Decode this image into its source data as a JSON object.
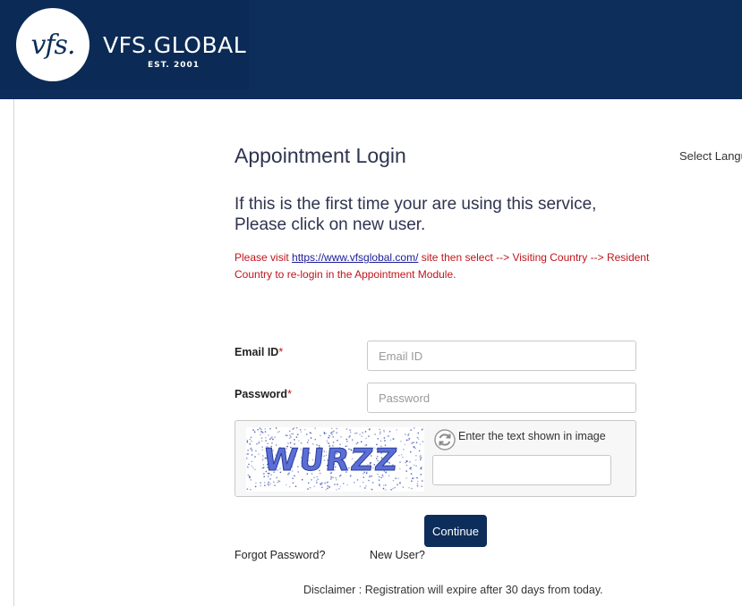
{
  "header": {
    "logo_mark": "vfs.",
    "brand": "VFS.GLOBAL",
    "established": "EST. 2001",
    "background_color": "#0d2d5a"
  },
  "main": {
    "title": "Appointment Login",
    "language_selector": "Select Language",
    "intro_line1": "If this is the first time your are using this service,",
    "intro_line2": "Please click on new user.",
    "notice_prefix": "Please visit ",
    "notice_link": "https://www.vfsglobal.com/",
    "notice_suffix": " site then select --> Visiting Country --> Resident Country to re-login in the Appointment Module.",
    "notice_color": "#c0141b"
  },
  "form": {
    "email_label": "Email ID",
    "email_placeholder": "Email ID",
    "email_value": "",
    "password_label": "Password",
    "password_placeholder": "Password",
    "password_value": "",
    "required_mark": "*",
    "captcha_text": "WURZZ",
    "captcha_prompt": "Enter the text shown in image",
    "captcha_value": "",
    "refresh_icon": "refresh-icon",
    "submit_label": "Continue",
    "submit_color": "#0d2d5a"
  },
  "links": {
    "forgot_password": "Forgot Password?",
    "new_user": "New User?"
  },
  "footer": {
    "disclaimer": "Disclaimer : Registration will expire after 30 days from today."
  }
}
